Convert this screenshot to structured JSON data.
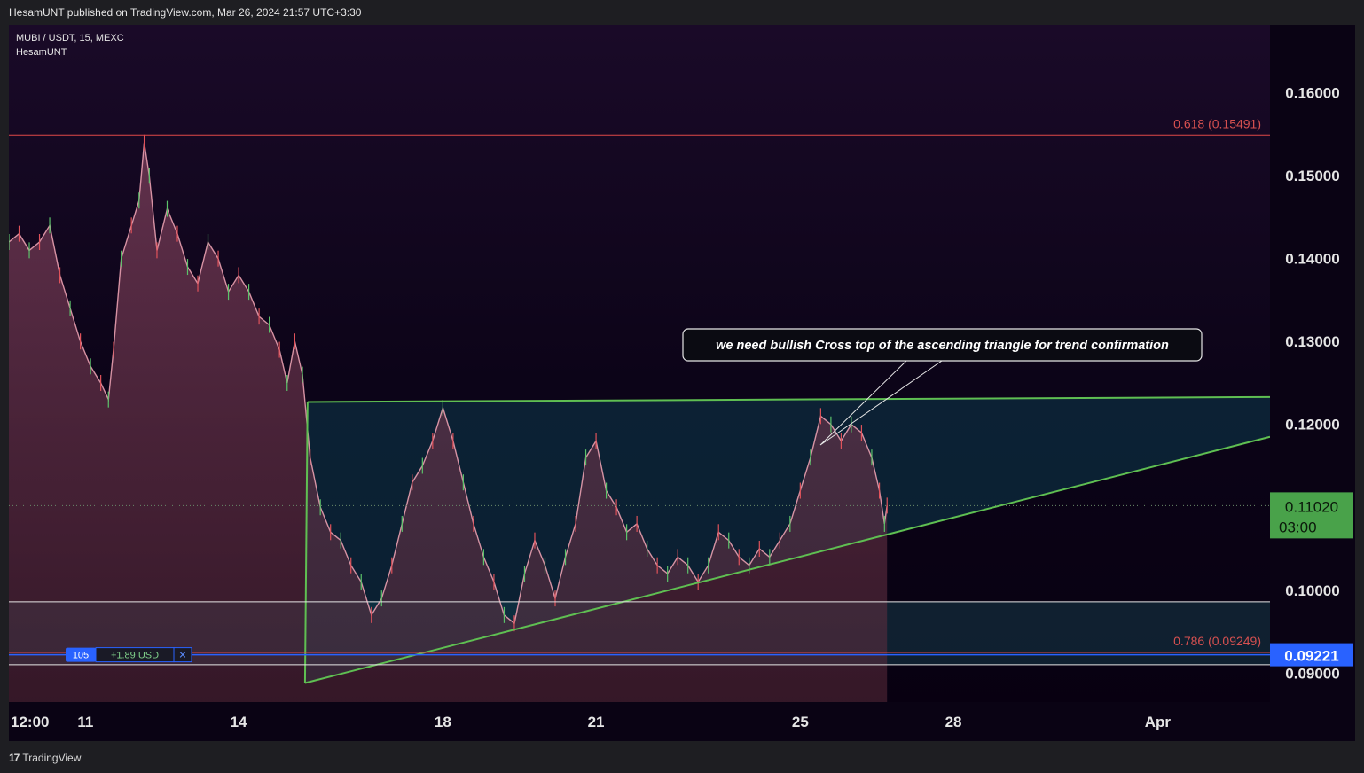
{
  "header": {
    "published": "HesamUNT published on TradingView.com, Mar 26, 2024 21:57 UTC+3:30"
  },
  "symbol": {
    "line1": "MUBI / USDT, 15, MEXC",
    "line2": "HesamUNT"
  },
  "footer": {
    "logo_mark": "17",
    "logo_text": "TradingView"
  },
  "colors": {
    "background": "#10061c",
    "triangle_line": "#5fbf52",
    "fib_line": "#e04848",
    "price_label_bg": "#49a24a",
    "position_blue": "#2962ff"
  },
  "annotation": {
    "text": "we need bullish Cross top of the ascending triangle for trend confirmation"
  },
  "fib_levels": [
    {
      "label": "0.618 (0.15491)",
      "price": 0.15491
    },
    {
      "label": "0.786 (0.09249)",
      "price": 0.09249
    }
  ],
  "last_price": {
    "value": "0.11020",
    "countdown": "03:00",
    "price": 0.1102
  },
  "position": {
    "qty": "105",
    "pnl": "+1.89 USD",
    "close": "✕",
    "price": 0.09221,
    "label": "0.09221"
  },
  "chart_data": {
    "type": "line",
    "title": "",
    "y_axis": {
      "ylim": [
        0.0865,
        0.1682
      ],
      "ticks": [
        "0.16000",
        "0.15000",
        "0.14000",
        "0.13000",
        "0.12000",
        "0.10000",
        "0.09000"
      ],
      "tick_values": [
        0.16,
        0.15,
        0.14,
        0.13,
        0.12,
        0.1,
        0.09
      ]
    },
    "x_axis": {
      "labels": [
        "12:00",
        "11",
        "14",
        "18",
        "21",
        "25",
        "28",
        "Apr"
      ],
      "day_positions": [
        9.5,
        11,
        14,
        18,
        21,
        25,
        28,
        32
      ],
      "xlim": [
        9.5,
        34.2
      ]
    },
    "series": [
      {
        "values": [
          [
            9.5,
            0.142
          ],
          [
            9.7,
            0.143
          ],
          [
            9.9,
            0.141
          ],
          [
            10.1,
            0.142
          ],
          [
            10.3,
            0.144
          ],
          [
            10.5,
            0.138
          ],
          [
            10.7,
            0.134
          ],
          [
            10.9,
            0.13
          ],
          [
            11.1,
            0.127
          ],
          [
            11.3,
            0.125
          ],
          [
            11.45,
            0.123
          ],
          [
            11.55,
            0.129
          ],
          [
            11.7,
            0.14
          ],
          [
            11.9,
            0.144
          ],
          [
            12.05,
            0.147
          ],
          [
            12.15,
            0.154
          ],
          [
            12.25,
            0.15
          ],
          [
            12.4,
            0.141
          ],
          [
            12.6,
            0.146
          ],
          [
            12.8,
            0.143
          ],
          [
            13.0,
            0.139
          ],
          [
            13.2,
            0.137
          ],
          [
            13.4,
            0.142
          ],
          [
            13.6,
            0.14
          ],
          [
            13.8,
            0.136
          ],
          [
            14.0,
            0.138
          ],
          [
            14.2,
            0.136
          ],
          [
            14.4,
            0.133
          ],
          [
            14.6,
            0.132
          ],
          [
            14.8,
            0.129
          ],
          [
            14.95,
            0.125
          ],
          [
            15.1,
            0.13
          ],
          [
            15.25,
            0.126
          ],
          [
            15.4,
            0.116
          ],
          [
            15.6,
            0.11
          ],
          [
            15.8,
            0.107
          ],
          [
            16.0,
            0.106
          ],
          [
            16.2,
            0.103
          ],
          [
            16.4,
            0.101
          ],
          [
            16.6,
            0.097
          ],
          [
            16.8,
            0.099
          ],
          [
            17.0,
            0.103
          ],
          [
            17.2,
            0.108
          ],
          [
            17.4,
            0.113
          ],
          [
            17.6,
            0.115
          ],
          [
            17.8,
            0.118
          ],
          [
            18.0,
            0.122
          ],
          [
            18.2,
            0.118
          ],
          [
            18.4,
            0.113
          ],
          [
            18.6,
            0.108
          ],
          [
            18.8,
            0.104
          ],
          [
            19.0,
            0.101
          ],
          [
            19.2,
            0.097
          ],
          [
            19.4,
            0.096
          ],
          [
            19.6,
            0.102
          ],
          [
            19.8,
            0.106
          ],
          [
            20.0,
            0.103
          ],
          [
            20.2,
            0.099
          ],
          [
            20.4,
            0.104
          ],
          [
            20.6,
            0.108
          ],
          [
            20.8,
            0.116
          ],
          [
            21.0,
            0.118
          ],
          [
            21.2,
            0.112
          ],
          [
            21.4,
            0.11
          ],
          [
            21.6,
            0.107
          ],
          [
            21.8,
            0.108
          ],
          [
            22.0,
            0.105
          ],
          [
            22.2,
            0.103
          ],
          [
            22.4,
            0.102
          ],
          [
            22.6,
            0.104
          ],
          [
            22.8,
            0.103
          ],
          [
            23.0,
            0.101
          ],
          [
            23.2,
            0.103
          ],
          [
            23.4,
            0.107
          ],
          [
            23.6,
            0.106
          ],
          [
            23.8,
            0.104
          ],
          [
            24.0,
            0.103
          ],
          [
            24.2,
            0.105
          ],
          [
            24.4,
            0.104
          ],
          [
            24.6,
            0.106
          ],
          [
            24.8,
            0.108
          ],
          [
            25.0,
            0.112
          ],
          [
            25.2,
            0.116
          ],
          [
            25.4,
            0.121
          ],
          [
            25.6,
            0.12
          ],
          [
            25.8,
            0.118
          ],
          [
            26.0,
            0.12
          ],
          [
            26.2,
            0.119
          ],
          [
            26.4,
            0.116
          ],
          [
            26.55,
            0.112
          ],
          [
            26.65,
            0.108
          ],
          [
            26.7,
            0.1102
          ]
        ]
      }
    ],
    "drawings": {
      "ascending_triangle": {
        "top_start": [
          15.35,
          0.1227
        ],
        "top_end": [
          34.2,
          0.1233
        ],
        "bottom_start": [
          15.3,
          0.0888
        ],
        "bottom_end": [
          34.2,
          0.1185
        ]
      },
      "support_zone": [
        0.091,
        0.0986
      ],
      "last_price_dotted": 0.1102
    }
  }
}
